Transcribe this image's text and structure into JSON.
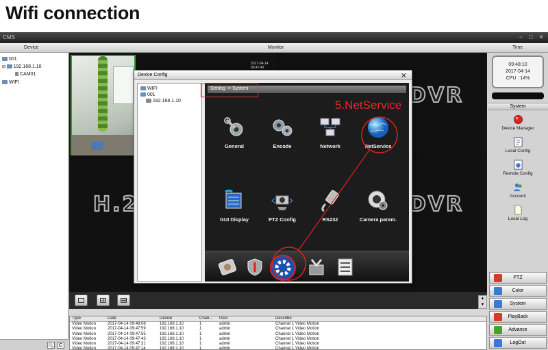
{
  "heading": "Wifi connection",
  "window": {
    "title": "CMS",
    "minimize": "−",
    "restore": "□",
    "close": "✕"
  },
  "columns": {
    "device": "Device",
    "monitor": "Monitor",
    "time": "Time"
  },
  "device_tree": {
    "root": "001",
    "ip": "192.168.1.10",
    "camera": "CAM01",
    "wifi": "WIFI"
  },
  "device_bottom": {
    "search": "🔍",
    "refresh": "C"
  },
  "monitor": {
    "overlay_timestamp": "2017-04-14 09:47:49",
    "watermark_left": "H.2",
    "watermark_right": "DVR",
    "watermark_top": "DVR"
  },
  "view_buttons": [
    "single",
    "quad",
    "nine"
  ],
  "log": {
    "headers": [
      "Type",
      "Date",
      "Device",
      "Chan...",
      "User",
      "Describe"
    ],
    "rows": [
      [
        "Video Motion",
        "2017-04-14 09:48:08",
        "192.168.1.10",
        "1",
        "admin",
        "Channel 1 Video Motion"
      ],
      [
        "Video Motion",
        "2017-04-14 09:47:59",
        "192.168.1.10",
        "1",
        "admin",
        "Channel 1 Video Motion"
      ],
      [
        "Video Motion",
        "2017-04-14 09:47:55",
        "192.168.1.10",
        "1",
        "admin",
        "Channel 1 Video Motion"
      ],
      [
        "Video Motion",
        "2017-04-14 09:47:43",
        "192.168.1.10",
        "1",
        "admin",
        "Channel 1 Video Motion"
      ],
      [
        "Video Motion",
        "2017-04-14 09:47:31",
        "192.168.1.10",
        "1",
        "admin",
        "Channel 1 Video Motion"
      ],
      [
        "Video Motion",
        "2017-04-14 09:47:14",
        "192.168.1.10",
        "1",
        "admin",
        "Channel 1 Video Motion"
      ],
      [
        "Video Motion",
        "2017-04-14 09:47:11",
        "192.168.1.10",
        "1",
        "admin",
        "Channel 1 Video Motion"
      ],
      [
        "Video Motion",
        "2017-04-14 09:47:07",
        "192.168.1.10",
        "1",
        "admin",
        "Channel 1 Video Motion"
      ]
    ]
  },
  "clock": {
    "time": "09:48:10",
    "date": "2017-04-14",
    "cpu": "CPU : 14%"
  },
  "system_header": "System",
  "system_menu": [
    "Device Manager",
    "Local Config",
    "Remote Config",
    "Account",
    "Local Log"
  ],
  "side_buttons": [
    "PTZ",
    "Color",
    "System",
    "PlayBack",
    "Advance",
    "LogOut"
  ],
  "side_colors": [
    "#d23a2a",
    "#3a7ad2",
    "#3a7ad2",
    "#d23a2a",
    "#4aa02a",
    "#3a7ad2"
  ],
  "dialog": {
    "title": "Device Config",
    "close": "✕",
    "tree_wifi": "WIFI",
    "tree_root": "001",
    "tree_ip": "192.168.1.10",
    "breadcrumb": "Setting -> System",
    "grid": [
      "General",
      "Encode",
      "Network",
      "NetService",
      "GUI Display",
      "PTZ Config",
      "RS232",
      "Camera param."
    ],
    "dock": [
      "disk-icon",
      "shield-icon",
      "gear-icon",
      "tools-icon",
      "checklist-icon"
    ]
  },
  "callout": "5.NetService",
  "accent": "#e62828"
}
